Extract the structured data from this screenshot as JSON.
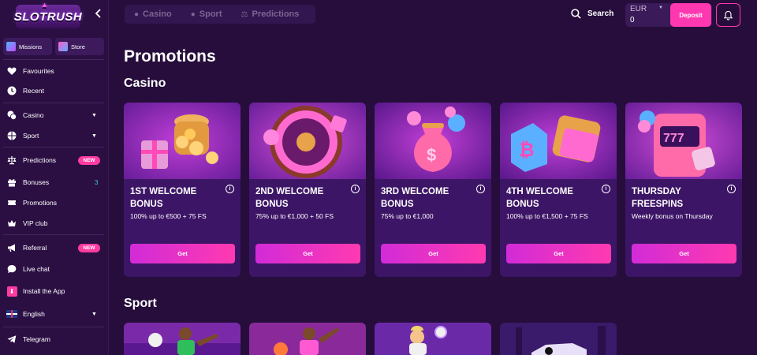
{
  "brand": {
    "logo_text": "SLOTRUSH"
  },
  "sidebar": {
    "quick": [
      {
        "label": "Missions",
        "icon": "missions-icon"
      },
      {
        "label": "Store",
        "icon": "store-icon"
      }
    ],
    "items": [
      {
        "label": "Favourites",
        "icon": "heart-icon"
      },
      {
        "label": "Recent",
        "icon": "clock-icon"
      },
      {
        "label": "Casino",
        "icon": "casino-chips-icon"
      },
      {
        "label": "Sport",
        "icon": "ball-icon"
      },
      {
        "label": "Predictions",
        "icon": "scales-icon",
        "badge": "NEW"
      },
      {
        "label": "Bonuses",
        "icon": "gift-icon",
        "count": "3"
      },
      {
        "label": "Promotions",
        "icon": "ticket-icon"
      },
      {
        "label": "VIP club",
        "icon": "crown-icon"
      },
      {
        "label": "Referral",
        "icon": "megaphone-icon",
        "badge": "NEW"
      },
      {
        "label": "Live chat",
        "icon": "chat-icon"
      },
      {
        "label": "Install the App",
        "icon": "download-icon"
      },
      {
        "label": "English",
        "icon": "uk-flag-icon"
      },
      {
        "label": "Telegram",
        "icon": "telegram-icon"
      }
    ]
  },
  "header": {
    "tabs": [
      {
        "label": "Casino",
        "icon": "casino-chips-icon"
      },
      {
        "label": "Sport",
        "icon": "ball-icon"
      },
      {
        "label": "Predictions",
        "icon": "scales-icon"
      }
    ],
    "search_label": "Search",
    "wallet": {
      "currency": "EUR",
      "amount": "0"
    },
    "deposit_label": "Deposit"
  },
  "main": {
    "page_title": "Promotions",
    "casino_title": "Casino",
    "sport_title": "Sport",
    "casino_cards": [
      {
        "title": "1ST WELCOME BONUS",
        "desc": "100% up to €500 + 75 FS",
        "button": "Get",
        "art": "treasure-pot"
      },
      {
        "title": "2ND WELCOME BONUS",
        "desc": "75% up to €1,000 + 50 FS",
        "button": "Get",
        "art": "roulette-wheel"
      },
      {
        "title": "3RD WELCOME BONUS",
        "desc": "75% up to €1,000",
        "button": "Get",
        "art": "money-bag"
      },
      {
        "title": "4TH WELCOME BONUS",
        "desc": "100% up to €1,500 + 75 FS",
        "button": "Get",
        "art": "crypto-wallet"
      },
      {
        "title": "THURSDAY FREESPINS",
        "desc": "Weekly bonus on Thursday",
        "button": "Get",
        "art": "slot-machine"
      }
    ],
    "sport_cards": [
      "football-player",
      "basketball-player",
      "tennis-player",
      "racing-car"
    ]
  },
  "colors": {
    "background": "#260d3b",
    "sidebar": "#2b0f43",
    "card": "#3d1566",
    "accent_pink": "#ff38b0",
    "accent_magenta": "#d12bd8",
    "count_cyan": "#37c9e0"
  }
}
